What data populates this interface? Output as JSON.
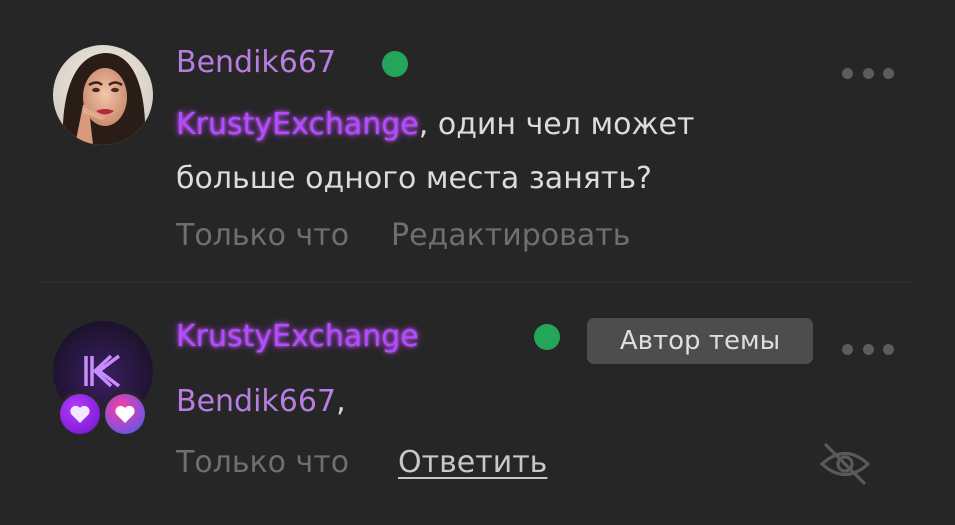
{
  "comments": [
    {
      "author": "Bendik667",
      "online": true,
      "mention": "KrustyExchange",
      "text_after_mention": ", один чел может",
      "text_line_2": "больше одного места занять?",
      "time": "Только что",
      "edit_label": "Редактировать"
    },
    {
      "author": "KrustyExchange",
      "online": true,
      "author_badge": "Автор темы",
      "mention": "Bendik667",
      "text_after_mention": ",",
      "time": "Только что",
      "reply_label": "Ответить",
      "avatar_letter": "K"
    }
  ],
  "colors": {
    "background": "#262626",
    "username_plain": "#b77de0",
    "username_glow": "#b34bff",
    "online": "#23a55a",
    "meta_text": "#6f6f6f",
    "body_text": "#dcdcdc",
    "badge_bg": "#4d4d4d"
  },
  "icons": {
    "more": "more-dots-icon",
    "hidden": "eye-off-icon",
    "hearts": [
      "heart-icon",
      "heart-icon"
    ]
  }
}
